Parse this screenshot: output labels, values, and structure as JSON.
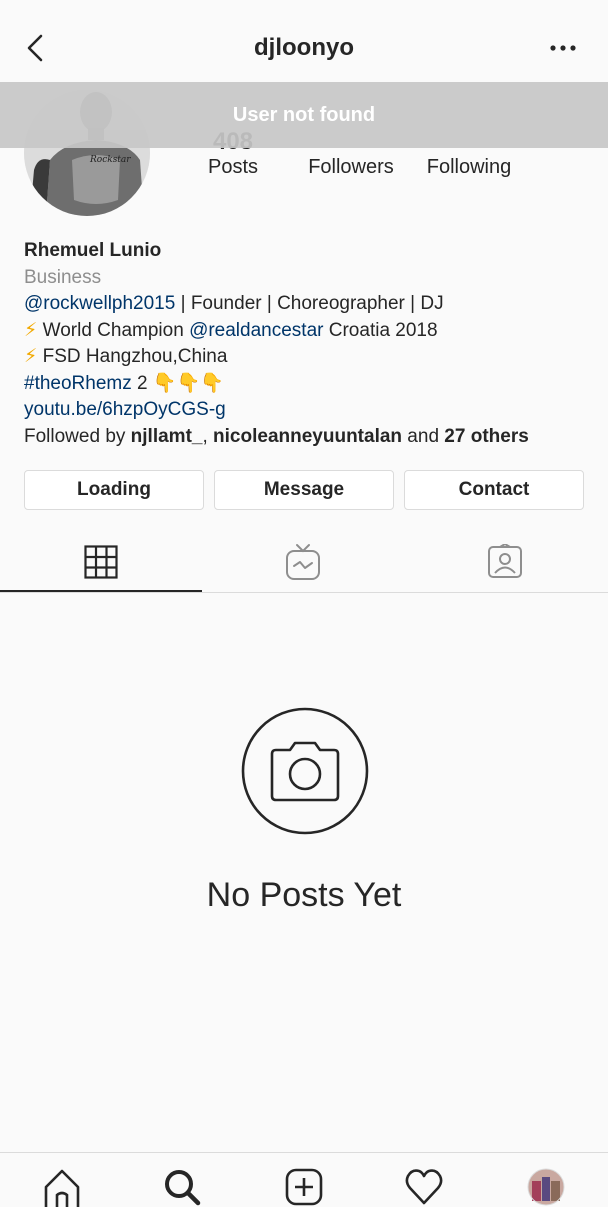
{
  "header": {
    "title": "djloonyo",
    "back_icon": "chevron-left-icon",
    "more_icon": "more-horizontal-icon"
  },
  "toast": {
    "text": "User not found"
  },
  "stats": {
    "posts_count": "408",
    "posts_label": "Posts",
    "followers_label": "Followers",
    "following_label": "Following"
  },
  "bio": {
    "name": "Rhemuel Lunio",
    "category": "Business",
    "line1_mention": "@rockwellph2015",
    "line1_rest": " | Founder | Choreographer | DJ",
    "line2_emoji": "⚡",
    "line2_pre": " World Champion ",
    "line2_mention": "@realdancestar",
    "line2_post": " Croatia 2018",
    "line3_emoji": "⚡",
    "line3_text": " FSD Hangzhou,China",
    "line4_hashtag": "#theoRhemz",
    "line4_rest": " 2 ",
    "line4_emojis": "👇👇👇",
    "website": "youtu.be/6hzpOyCGS-g",
    "followed_by_prefix": "Followed by ",
    "followed_by_user1": "njllamt_",
    "followed_by_sep": ", ",
    "followed_by_user2": "nicoleanneyuuntalan",
    "followed_by_and": " and ",
    "followed_by_others": "27 others"
  },
  "buttons": {
    "follow_label": "Loading",
    "message_label": "Message",
    "contact_label": "Contact"
  },
  "tabs": [
    {
      "name": "grid",
      "icon": "grid-icon"
    },
    {
      "name": "igtv",
      "icon": "igtv-icon"
    },
    {
      "name": "tagged",
      "icon": "tagged-icon"
    }
  ],
  "empty_state": {
    "icon": "camera-icon",
    "text": "No Posts Yet"
  },
  "bottom_nav": [
    {
      "name": "home",
      "icon": "home-icon"
    },
    {
      "name": "search",
      "icon": "search-icon"
    },
    {
      "name": "new-post",
      "icon": "add-icon"
    },
    {
      "name": "activity",
      "icon": "heart-icon"
    },
    {
      "name": "profile",
      "icon": "profile-avatar-icon"
    }
  ],
  "colors": {
    "link": "#003569",
    "secondary_text": "#8e8e8e",
    "border": "#dbdbdb",
    "toast_bg": "#c7c7c7"
  }
}
